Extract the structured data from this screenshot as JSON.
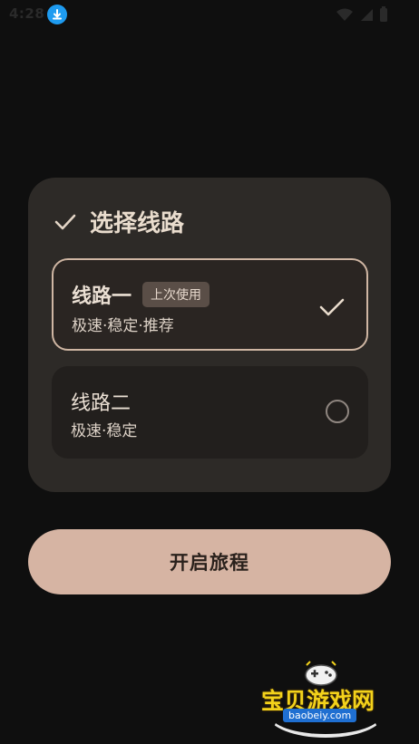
{
  "status_bar": {
    "time": "4:28"
  },
  "card": {
    "title": "选择线路",
    "options": [
      {
        "name": "线路一",
        "badge": "上次使用",
        "description": "极速·稳定·推荐",
        "selected": true
      },
      {
        "name": "线路二",
        "description": "极速·稳定",
        "selected": false
      }
    ]
  },
  "start_button": {
    "label": "开启旅程"
  },
  "watermark": {
    "brand": "宝贝游戏网",
    "domain": "baobeiy.com"
  },
  "colors": {
    "background": "#0f0f0f",
    "card": "#2d2a27",
    "accent": "#d6b4a3",
    "selected_border": "#cfb6a3"
  }
}
